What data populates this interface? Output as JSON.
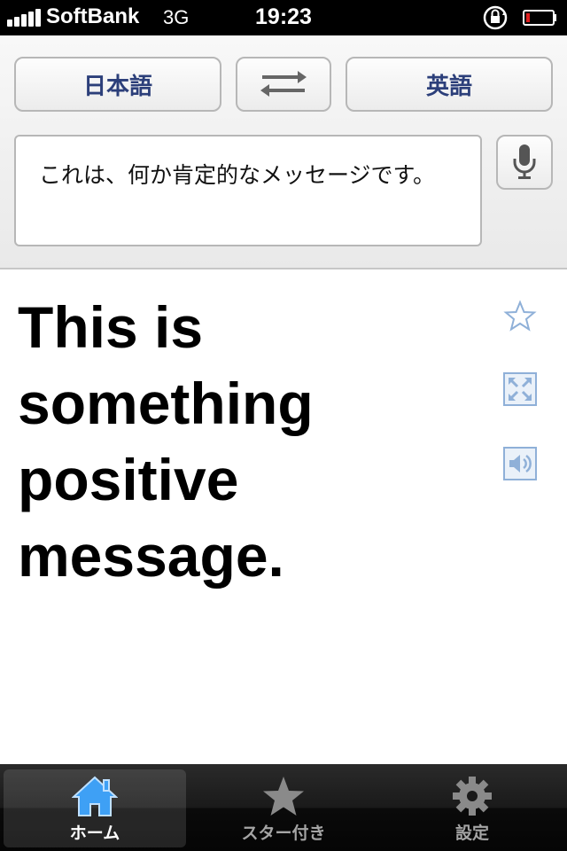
{
  "status": {
    "carrier": "SoftBank",
    "network": "3G",
    "time": "19:23"
  },
  "toolbar": {
    "source_language": "日本語",
    "target_language": "英語"
  },
  "input": {
    "text": "これは、何か肯定的なメッセージです。"
  },
  "result": {
    "translation": "This is something positive message."
  },
  "tabs": [
    {
      "label": "ホーム",
      "icon": "home-icon",
      "active": true
    },
    {
      "label": "スター付き",
      "icon": "star-icon",
      "active": false
    },
    {
      "label": "設定",
      "icon": "gear-icon",
      "active": false
    }
  ],
  "colors": {
    "accent": "#2c3f7a",
    "icon_blue": "#8fb0d8",
    "tab_active": "#3ea0f5"
  }
}
